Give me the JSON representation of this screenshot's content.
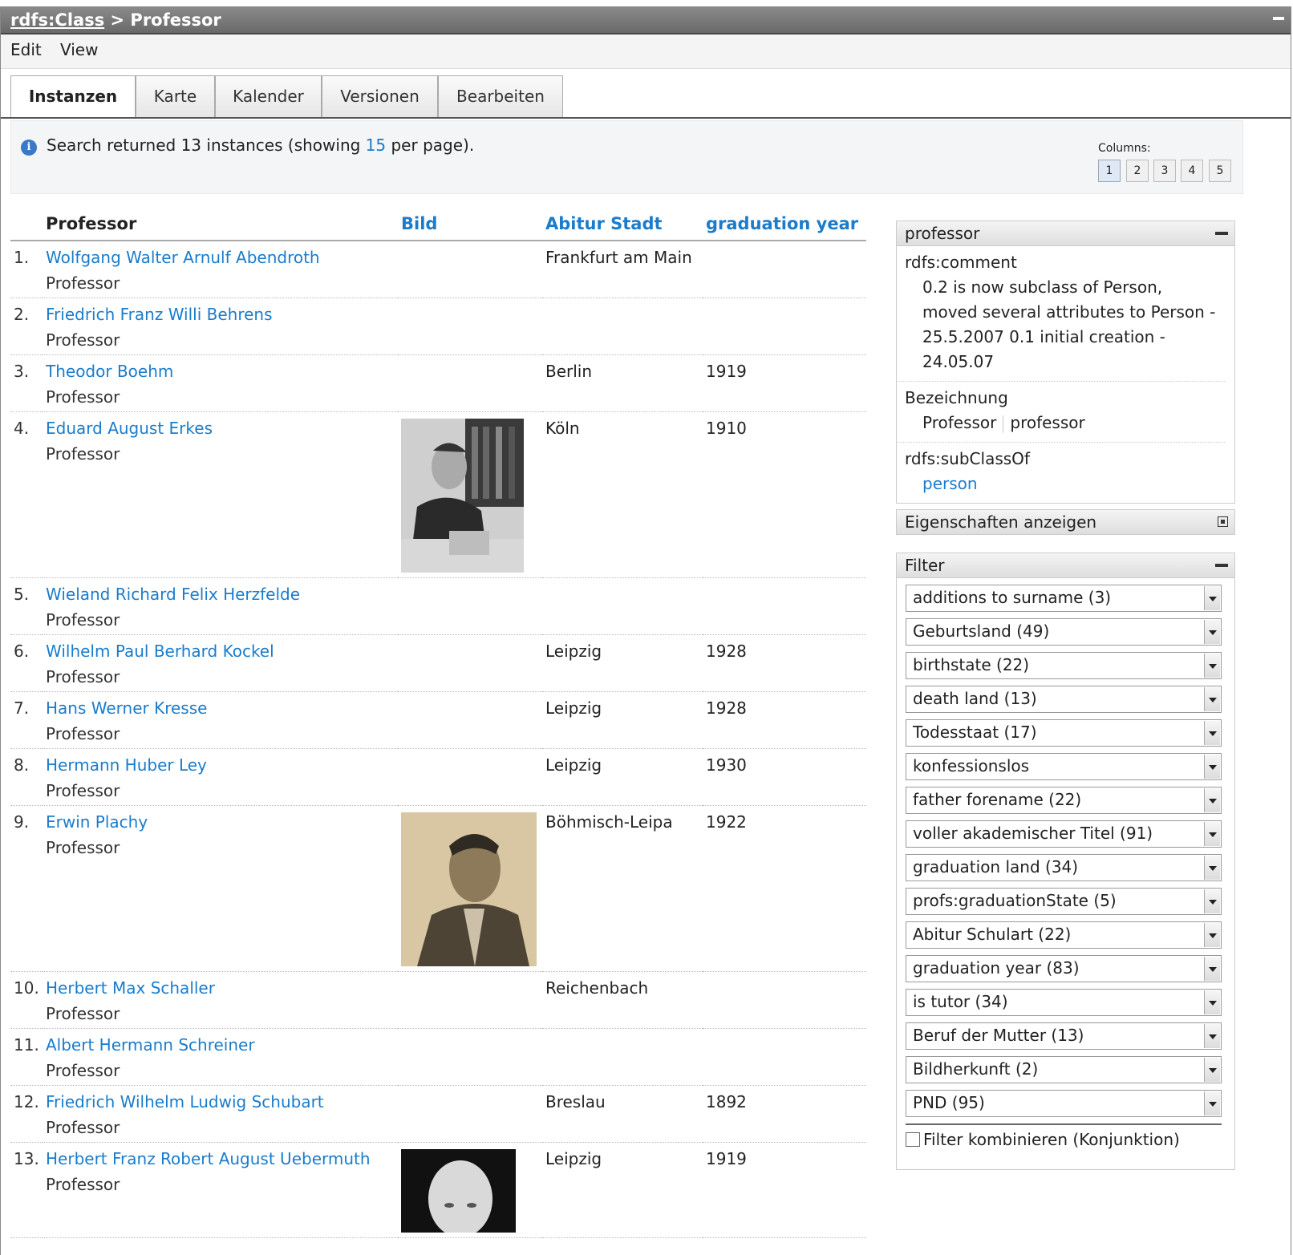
{
  "titlebar": {
    "class_link": "rdfs:Class",
    "separator": " > ",
    "current": "Professor"
  },
  "menu": {
    "edit": "Edit",
    "view": "View"
  },
  "tabs": [
    "Instanzen",
    "Karte",
    "Kalender",
    "Versionen",
    "Bearbeiten"
  ],
  "info": {
    "prefix": "Search returned 13 instances (showing ",
    "per_page": "15",
    "suffix": " per page).",
    "columns_label": "Columns:",
    "column_buttons": [
      "1",
      "2",
      "3",
      "4",
      "5"
    ]
  },
  "table": {
    "headers": [
      "Professor",
      "Bild",
      "Abitur Stadt",
      "graduation year"
    ],
    "rows": [
      {
        "num": "1.",
        "name": "Wolfgang Walter Arnulf Abendroth",
        "type": "Professor",
        "city": "Frankfurt am Main",
        "year": "",
        "photo": ""
      },
      {
        "num": "2.",
        "name": "Friedrich Franz Willi Behrens",
        "type": "Professor",
        "city": "",
        "year": "",
        "photo": ""
      },
      {
        "num": "3.",
        "name": "Theodor Boehm",
        "type": "Professor",
        "city": "Berlin",
        "year": "1919",
        "photo": ""
      },
      {
        "num": "4.",
        "name": "Eduard August Erkes",
        "type": "Professor",
        "city": "Köln",
        "year": "1910",
        "photo": "bw-desk"
      },
      {
        "num": "5.",
        "name": "Wieland Richard Felix Herzfelde",
        "type": "Professor",
        "city": "",
        "year": "",
        "photo": ""
      },
      {
        "num": "6.",
        "name": "Wilhelm Paul Berhard Kockel",
        "type": "Professor",
        "city": "Leipzig",
        "year": "1928",
        "photo": ""
      },
      {
        "num": "7.",
        "name": "Hans Werner Kresse",
        "type": "Professor",
        "city": "Leipzig",
        "year": "1928",
        "photo": ""
      },
      {
        "num": "8.",
        "name": "Hermann Huber Ley",
        "type": "Professor",
        "city": "Leipzig",
        "year": "1930",
        "photo": ""
      },
      {
        "num": "9.",
        "name": "Erwin Plachy",
        "type": "Professor",
        "city": "Böhmisch-Leipa",
        "year": "1922",
        "photo": "sepia-portrait"
      },
      {
        "num": "10.",
        "name": "Herbert Max Schaller",
        "type": "Professor",
        "city": "Reichenbach",
        "year": "",
        "photo": ""
      },
      {
        "num": "11.",
        "name": "Albert Hermann Schreiner",
        "type": "Professor",
        "city": "",
        "year": "",
        "photo": ""
      },
      {
        "num": "12.",
        "name": "Friedrich Wilhelm Ludwig Schubart",
        "type": "Professor",
        "city": "Breslau",
        "year": "1892",
        "photo": ""
      },
      {
        "num": "13.",
        "name": "Herbert Franz Robert August Uebermuth",
        "type": "Professor",
        "city": "Leipzig",
        "year": "1919",
        "photo": "bw-head"
      }
    ]
  },
  "sidebar": {
    "professor_box": {
      "title": "professor",
      "comment_label": "rdfs:comment",
      "comment_value": "0.2 is now subclass of Person, moved several attributes to Person - 25.5.2007 0.1 initial creation - 24.05.07",
      "bezeichnung_label": "Bezeichnung",
      "bezeichnung_values": [
        "Professor",
        "professor"
      ],
      "subclass_label": "rdfs:subClassOf",
      "subclass_value": "person"
    },
    "eigenschaften_title": "Eigenschaften anzeigen",
    "filter": {
      "title": "Filter",
      "options": [
        "additions to surname (3)",
        "Geburtsland (49)",
        "birthstate (22)",
        "death land (13)",
        "Todesstaat (17)",
        "konfessionslos",
        "father forename (22)",
        "voller akademischer Titel (91)",
        "graduation land (34)",
        "profs:graduationState (5)",
        "Abitur Schulart (22)",
        "graduation year (83)",
        "is tutor (34)",
        "Beruf der Mutter (13)",
        "Bildherkunft (2)",
        "PND (95)"
      ],
      "combine_label": "Filter kombinieren (Konjunktion)"
    }
  },
  "colors": {
    "link": "#1a7ccc",
    "titlebar": "#7a7a7a",
    "info_bg": "#f3f5f6"
  }
}
